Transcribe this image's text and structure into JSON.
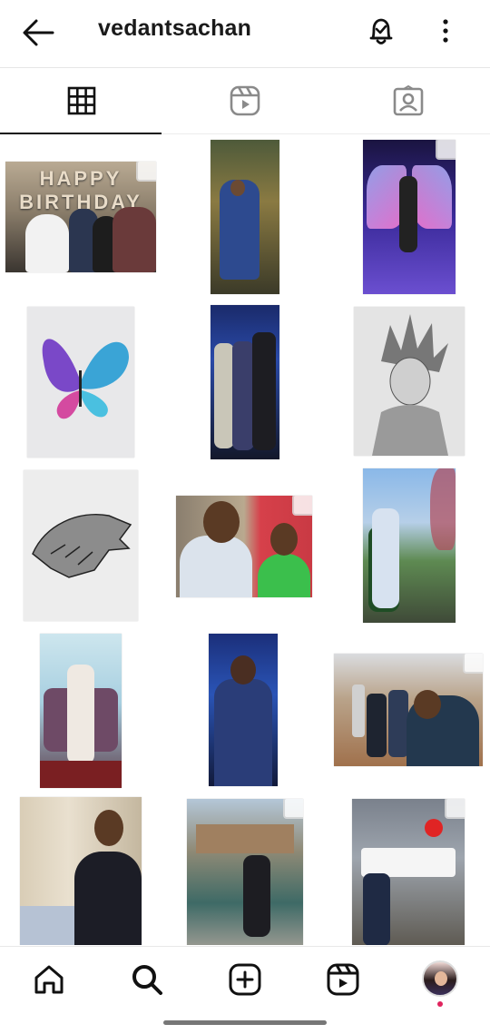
{
  "header": {
    "username": "vedantsachan",
    "back_icon": "arrow-left-icon",
    "notify_icon": "bell-icon",
    "more_icon": "more-vertical-icon"
  },
  "tabs": [
    {
      "name": "posts",
      "icon": "grid-icon",
      "active": true
    },
    {
      "name": "reels",
      "icon": "reels-icon",
      "active": false
    },
    {
      "name": "tagged",
      "icon": "tagged-icon",
      "active": false
    }
  ],
  "grid": {
    "posts": [
      {
        "caption": "HAPPY BIRTHDAY",
        "kind": "birthday-group-photo"
      },
      {
        "kind": "portrait-cafe"
      },
      {
        "kind": "angel-wings-photo"
      },
      {
        "kind": "butterfly-drawing"
      },
      {
        "kind": "group-neon-photo"
      },
      {
        "kind": "goku-sketch"
      },
      {
        "kind": "wolf-sketch"
      },
      {
        "kind": "selfie-duo"
      },
      {
        "kind": "portrait-outdoor"
      },
      {
        "kind": "portrait-sofa"
      },
      {
        "kind": "mirror-selfie"
      },
      {
        "kind": "group-selfie-outdoor"
      },
      {
        "kind": "portrait-palace"
      },
      {
        "kind": "portrait-stepwell"
      },
      {
        "kind": "portrait-chanderi-sign"
      }
    ]
  },
  "bottom_nav": [
    {
      "name": "home",
      "icon": "home-icon"
    },
    {
      "name": "search",
      "icon": "search-icon"
    },
    {
      "name": "create",
      "icon": "plus-square-icon"
    },
    {
      "name": "reels",
      "icon": "reels-icon"
    },
    {
      "name": "profile",
      "icon": "avatar"
    }
  ],
  "colors": {
    "accent_dot": "#e0245e",
    "divider": "#e6e6e6"
  }
}
